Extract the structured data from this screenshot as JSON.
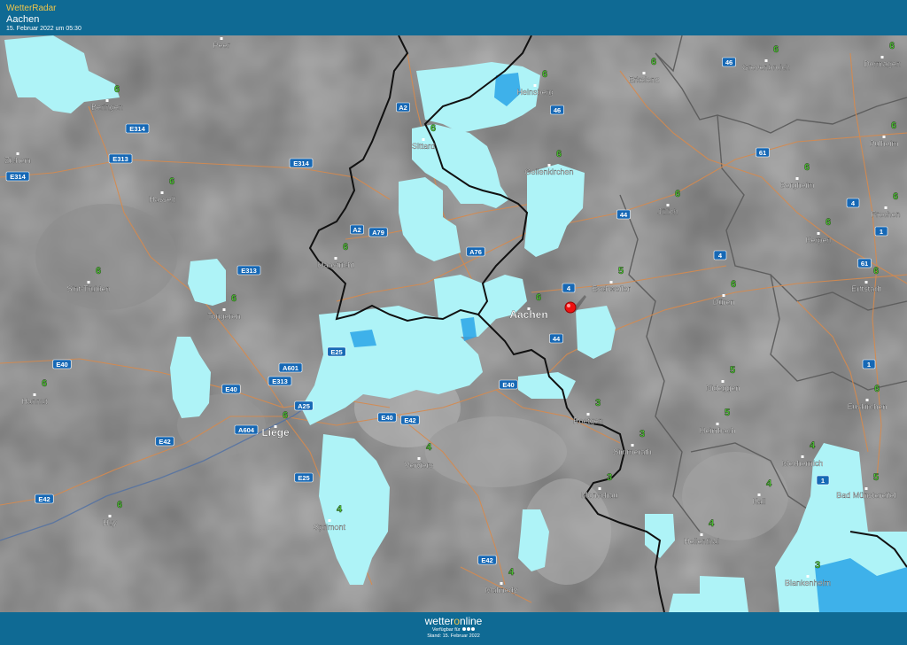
{
  "header": {
    "brand": "WetterRadar",
    "location": "Aachen",
    "timestamp": "15. Februar 2022 um 05:30"
  },
  "footer": {
    "logo_part1": "wetter",
    "logo_part2": "o",
    "logo_part3": "nline",
    "availability": "Verfügbar für",
    "stand": "Stand: 15. Februar 2022"
  },
  "colors": {
    "bar": "#0f6a94",
    "brand_yellow": "#f0c64a",
    "rain_light": "#aef3f7",
    "rain_medium": "#2aa4e8",
    "border": "#111111",
    "road": "#d9894a",
    "temp_text": "#56d63a"
  },
  "map": {
    "cities": [
      {
        "name": "Peer",
        "temp": ""
      },
      {
        "name": "Beringen",
        "temp": "6"
      },
      {
        "name": "Zichem",
        "temp": ""
      },
      {
        "name": "Hasselt",
        "temp": "6"
      },
      {
        "name": "Sint-Truiden",
        "temp": "6"
      },
      {
        "name": "Tongeren",
        "temp": "6"
      },
      {
        "name": "Hannut",
        "temp": "6"
      },
      {
        "name": "Huy",
        "temp": "6"
      },
      {
        "name": "Liege",
        "temp": "6"
      },
      {
        "name": "Maastricht",
        "temp": "6"
      },
      {
        "name": "Sittard",
        "temp": "6"
      },
      {
        "name": "Heinsberg",
        "temp": "6"
      },
      {
        "name": "Geilenkirchen",
        "temp": "6"
      },
      {
        "name": "Erkelenz",
        "temp": "6"
      },
      {
        "name": "Grevenbroich",
        "temp": "6"
      },
      {
        "name": "Dormagen",
        "temp": "6"
      },
      {
        "name": "Pulheim",
        "temp": "6"
      },
      {
        "name": "Bergheim",
        "temp": "6"
      },
      {
        "name": "Jülich",
        "temp": "6"
      },
      {
        "name": "Frechen",
        "temp": "6"
      },
      {
        "name": "Kerpen",
        "temp": "6"
      },
      {
        "name": "Erftstadt",
        "temp": "6"
      },
      {
        "name": "Eschweiler",
        "temp": "5"
      },
      {
        "name": "Düren",
        "temp": "6"
      },
      {
        "name": "Aachen",
        "temp": "6"
      },
      {
        "name": "Roetgen",
        "temp": "3"
      },
      {
        "name": "Nideggen",
        "temp": "5"
      },
      {
        "name": "Euskirchen",
        "temp": "6"
      },
      {
        "name": "Heimbach",
        "temp": "5"
      },
      {
        "name": "Simmerath",
        "temp": "3"
      },
      {
        "name": "Mechernich",
        "temp": "4"
      },
      {
        "name": "Monschau",
        "temp": "3"
      },
      {
        "name": "Kall",
        "temp": "4"
      },
      {
        "name": "Bad Münstereifel",
        "temp": "5"
      },
      {
        "name": "Verviers",
        "temp": "4"
      },
      {
        "name": "Sprimont",
        "temp": "4"
      },
      {
        "name": "Hellenthal",
        "temp": "4"
      },
      {
        "name": "Malmedy",
        "temp": "4"
      },
      {
        "name": "Blankenheim",
        "temp": "3"
      }
    ],
    "roads": [
      "E314",
      "E313",
      "E314",
      "E314",
      "A2",
      "A2",
      "A79",
      "A76",
      "E313",
      "E40",
      "A601",
      "E313",
      "E40",
      "E25",
      "A25",
      "A604",
      "E42",
      "E42",
      "E25",
      "E40",
      "E42",
      "E40",
      "E42",
      "44",
      "44",
      "4",
      "46",
      "46",
      "61",
      "61",
      "4",
      "1",
      "1",
      "1",
      "4"
    ]
  }
}
